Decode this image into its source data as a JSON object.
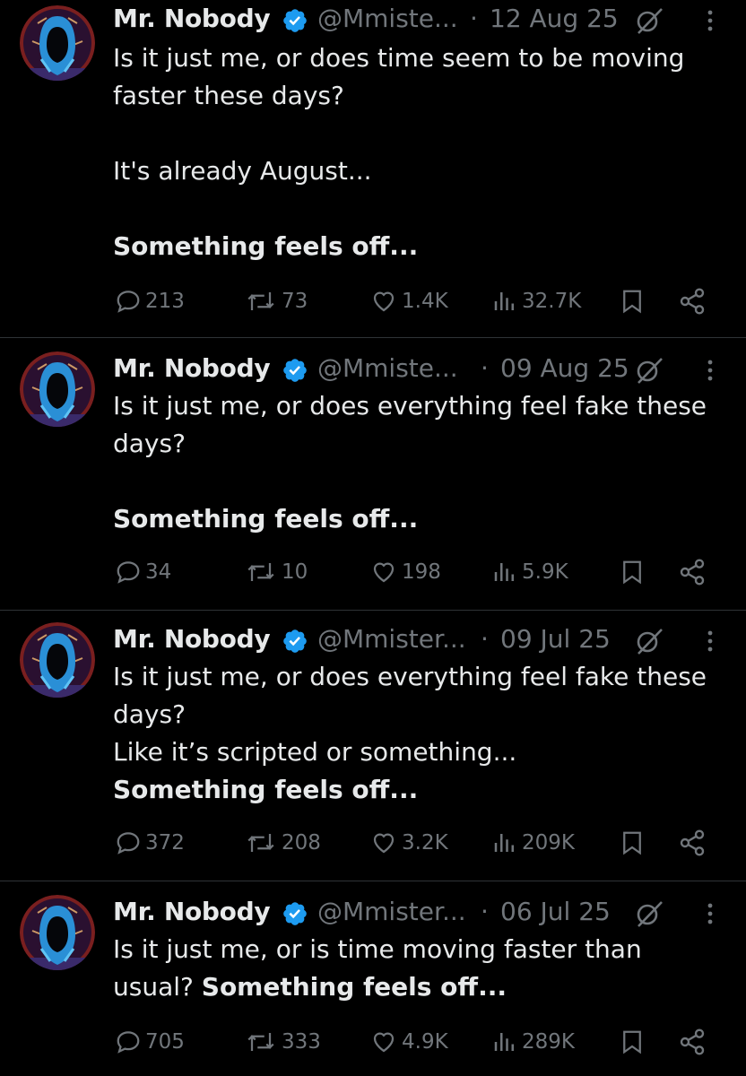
{
  "tweets": [
    {
      "name": "Mr. Nobody",
      "handle": "@Mmiste...",
      "date": "12 Aug 25",
      "lines": [
        "Is it just me, or does time seem to be moving",
        "faster these days?",
        "",
        "It's already August...",
        ""
      ],
      "bold_line": "Something feels off...",
      "replies": "213",
      "reposts": "73",
      "likes": "1.4K",
      "views": "32.7K"
    },
    {
      "name": "Mr. Nobody",
      "handle": "@Mmiste...",
      "date": "09 Aug 25",
      "lines": [
        "Is it just me, or does everything feel fake these",
        "days?",
        ""
      ],
      "bold_line": "Something feels off...",
      "replies": "34",
      "reposts": "10",
      "likes": "198",
      "views": "5.9K"
    },
    {
      "name": "Mr. Nobody",
      "handle": "@Mmister...",
      "date": "09 Jul 25",
      "lines": [
        "Is it just me, or does everything feel fake these",
        "days?",
        "Like it’s scripted or something..."
      ],
      "bold_line": "Something feels off...",
      "replies": "372",
      "reposts": "208",
      "likes": "3.2K",
      "views": "209K"
    },
    {
      "name": "Mr. Nobody",
      "handle": "@Mmister...",
      "date": "06 Jul 25",
      "lines": [
        "Is it just me, or is time moving faster than"
      ],
      "last_line_prefix": "usual? ",
      "bold_line": "Something feels off...",
      "replies": "705",
      "reposts": "333",
      "likes": "4.9K",
      "views": "289K"
    }
  ],
  "icons": {
    "reply": "reply-icon",
    "repost": "repost-icon",
    "like": "heart-icon",
    "views": "views-icon",
    "bookmark": "bookmark-icon",
    "share": "share-icon",
    "verified": "verified-badge-icon",
    "grok": "grok-icon",
    "more": "more-icon"
  },
  "colors": {
    "background": "#000000",
    "text": "#e7e9ea",
    "muted": "#71767b",
    "divider": "#2f3336",
    "verified": "#1d9bf0"
  }
}
